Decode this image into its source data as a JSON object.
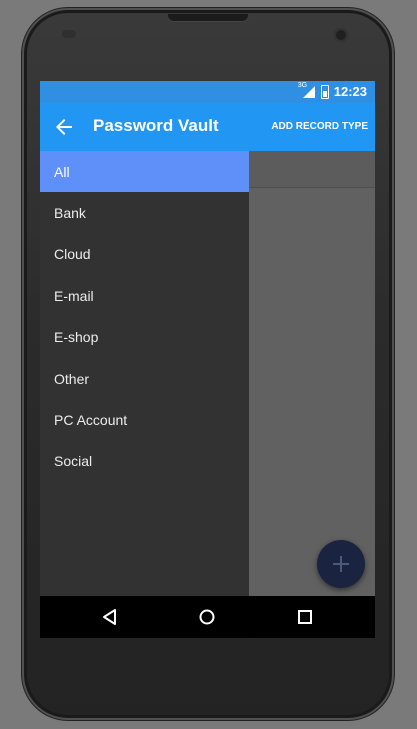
{
  "status_bar": {
    "network": "3G",
    "time": "12:23"
  },
  "app_bar": {
    "title": "Password Vault",
    "action_label": "ADD RECORD TYPE",
    "back_icon": "arrow-back-icon"
  },
  "drawer": {
    "selected": "All",
    "items": [
      {
        "label": "All"
      },
      {
        "label": "Bank"
      },
      {
        "label": "Cloud"
      },
      {
        "label": "E-mail"
      },
      {
        "label": "E-shop"
      },
      {
        "label": "Other"
      },
      {
        "label": "PC Account"
      },
      {
        "label": "Social"
      }
    ]
  },
  "fab": {
    "icon": "add-icon"
  },
  "nav_bar": {
    "back_icon": "nav-back-icon",
    "home_icon": "nav-home-icon",
    "recents_icon": "nav-recents-icon"
  },
  "colors": {
    "primary": "#2196f3",
    "status_bar": "#2f8fe3",
    "drawer_selected": "#5f8ff8",
    "drawer_bg": "#323232",
    "fab": "#1a2440"
  }
}
